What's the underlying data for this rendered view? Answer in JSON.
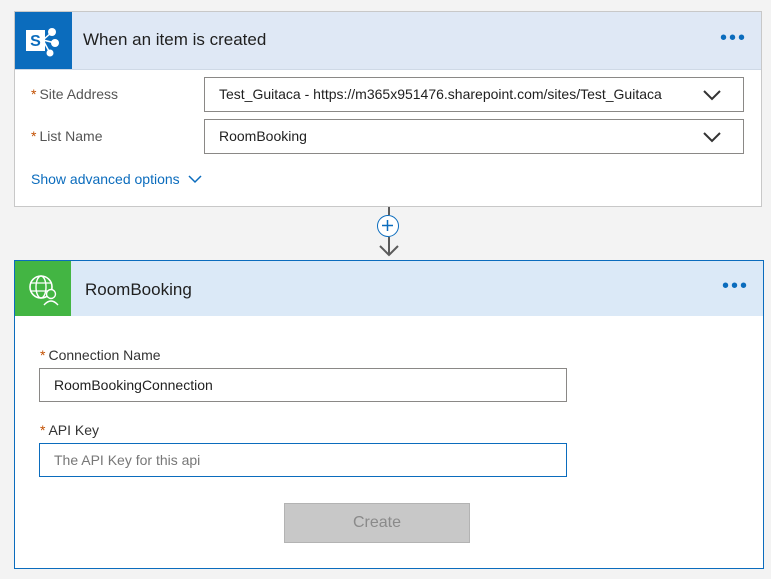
{
  "trigger": {
    "title": "When an item is created",
    "icon": "sharepoint-icon",
    "fields": [
      {
        "label": "Site Address",
        "value": "Test_Guitaca - https://m365x951476.sharepoint.com/sites/Test_Guitaca"
      },
      {
        "label": "List Name",
        "value": "RoomBooking"
      }
    ],
    "advanced_label": "Show advanced options"
  },
  "action": {
    "title": "RoomBooking",
    "icon": "globe-person-icon",
    "connection_label": "Connection Name",
    "connection_value": "RoomBookingConnection",
    "apikey_label": "API Key",
    "apikey_placeholder": "The API Key for this api",
    "create_label": "Create"
  },
  "menu_dots": "•••",
  "required_mark": "*",
  "colors": {
    "accent": "#0b6cbd",
    "sharepoint": "#0b6cbd",
    "connector_green": "#43b543",
    "required": "#c24f00"
  }
}
